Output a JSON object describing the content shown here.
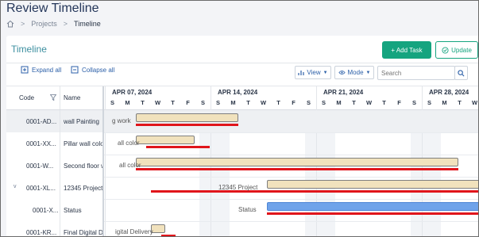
{
  "page": {
    "title": "Review Timeline"
  },
  "breadcrumb": {
    "home_icon": "home-icon",
    "projects": "Projects",
    "sep": ">",
    "current": "Timeline"
  },
  "card": {
    "title": "Timeline",
    "add_task": "+ Add Task",
    "update": "Update",
    "expand_all": "Expand all",
    "collapse_all": "Collapse all",
    "view": "View",
    "mode": "Mode",
    "search_placeholder": "Search"
  },
  "columns": {
    "code": "Code",
    "name": "Name"
  },
  "weeks": [
    "APR 07, 2024",
    "APR 14, 2024",
    "APR 21, 2024",
    "APR 28, 2024"
  ],
  "days": [
    "S",
    "M",
    "T",
    "W",
    "T",
    "F",
    "S",
    "S",
    "M",
    "T",
    "W",
    "T",
    "F",
    "S",
    "S",
    "M",
    "T",
    "W",
    "T",
    "F",
    "S",
    "S",
    "M",
    "T",
    "W"
  ],
  "rows": [
    {
      "code": "0001-AD...",
      "name": "wall Painting",
      "overlay": "g work",
      "expand": ""
    },
    {
      "code": "0001-XX...",
      "name": "Pillar wall colo",
      "overlay": "all color",
      "expand": ""
    },
    {
      "code": "0001-W...",
      "name": "Second floor wa",
      "overlay": "all color",
      "expand": ""
    },
    {
      "code": "0001-XL...",
      "name": "12345 Project",
      "overlay": "12345 Project",
      "expand": "v"
    },
    {
      "code": "0001-X...",
      "name": "Status",
      "overlay": "Status",
      "expand": ""
    },
    {
      "code": "0001-KR...",
      "name": "Final Digital D",
      "overlay": "igital Delivery",
      "expand": ""
    }
  ],
  "colors": {
    "accent": "#15a47f",
    "bar_tan": "#f1e2bd",
    "bar_blue": "#6fa3ea",
    "red": "#e0151b"
  }
}
